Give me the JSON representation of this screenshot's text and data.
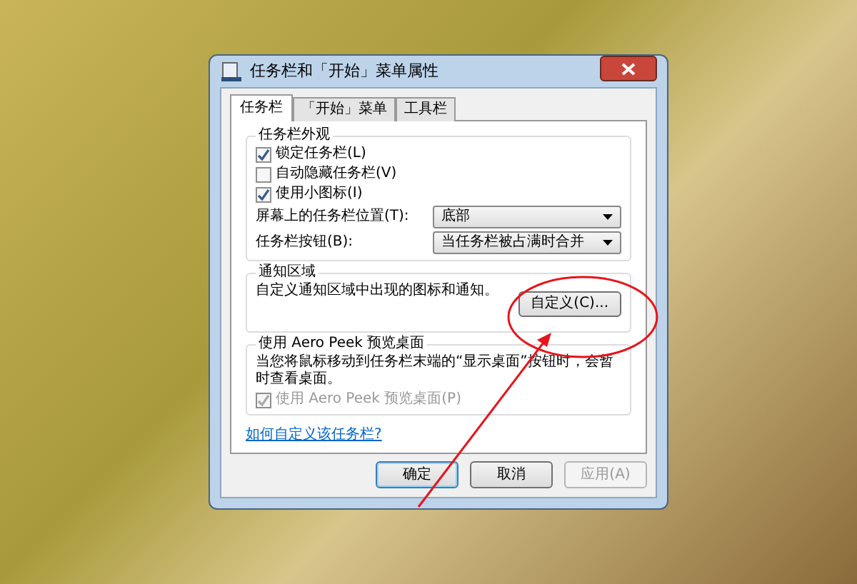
{
  "window": {
    "title": "任务栏和「开始」菜单属性"
  },
  "tabs": [
    {
      "label": "任务栏",
      "selected": true
    },
    {
      "label": "「开始」菜单",
      "selected": false
    },
    {
      "label": "工具栏",
      "selected": false
    }
  ],
  "appearance": {
    "heading": "任务栏外观",
    "checkboxes": [
      {
        "label": "锁定任务栏(L)",
        "checked": true
      },
      {
        "label": "自动隐藏任务栏(V)",
        "checked": false
      },
      {
        "label": "使用小图标(I)",
        "checked": true
      }
    ],
    "dropdowns": [
      {
        "label": "屏幕上的任务栏位置(T):",
        "value": "底部"
      },
      {
        "label": "任务栏按钮(B):",
        "value": "当任务栏被占满时合并"
      }
    ]
  },
  "notification": {
    "heading": "通知区域",
    "text": "自定义通知区域中出现的图标和通知。",
    "button": "自定义(C)..."
  },
  "aero_peek": {
    "heading": "使用 Aero Peek 预览桌面",
    "text": "当您将鼠标移动到任务栏末端的“显示桌面”按钮时，会暂时查看桌面。",
    "checkbox": {
      "label": "使用 Aero Peek 预览桌面(P)",
      "checked": true,
      "disabled": true
    }
  },
  "link": "如何自定义该任务栏?",
  "buttons": [
    {
      "label": "确定",
      "disabled": false,
      "default": true
    },
    {
      "label": "取消",
      "disabled": false,
      "default": false
    },
    {
      "label": "应用(A)",
      "disabled": true,
      "default": false
    }
  ]
}
